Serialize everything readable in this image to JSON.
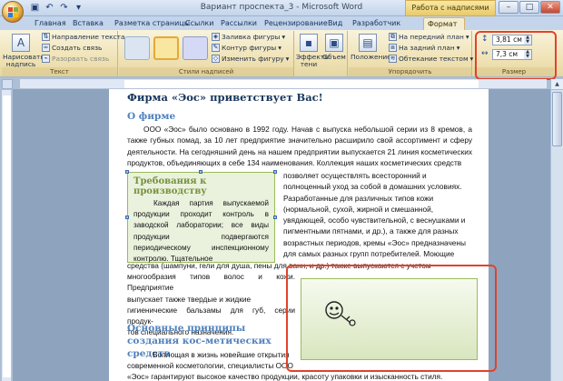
{
  "window": {
    "title": "Вариант проспекта_3 - Microsoft Word",
    "context_tab_header": "Работа с надписями"
  },
  "tabs": [
    "Главная",
    "Вставка",
    "Разметка страницы",
    "Ссылки",
    "Рассылки",
    "Рецензирование",
    "Вид",
    "Разработчик",
    "Формат"
  ],
  "ribbon": {
    "text_group": {
      "label": "Текст",
      "draw_textbox": "Нарисовать надпись",
      "text_direction": "Направление текста",
      "create_link": "Создать связь",
      "break_link": "Разорвать связь"
    },
    "styles_group": {
      "label": "Стили надписей",
      "fill": "Заливка фигуры",
      "outline": "Контур фигуры",
      "change_shape": "Изменить фигуру",
      "style_colors": [
        "#dbe5f1",
        "#f9e6a0",
        "#d4daf5"
      ]
    },
    "effects_group": {
      "shadow": "Эффекты тени",
      "volume": "Объем"
    },
    "arrange_group": {
      "label": "Упорядочить",
      "position": "Положение",
      "front": "На передний план",
      "back": "На задний план",
      "wrap": "Обтекание текстом"
    },
    "size_group": {
      "label": "Размер",
      "height": "3,81 см",
      "width": "7,3 см"
    }
  },
  "document": {
    "title": "Фирма «Эос» приветствует Вас!",
    "about_heading": "О фирме",
    "about_text": "ООО «Эос» было основано в 1992 году. Начав с выпуска небольшой серии из 8 кремов, а также губных помад, за 10 лет предприятие значительно расширило свой ассортимент и сферу деятельности. На сегодняшний день на нашем предприятии выпускается 21 линия косметических продуктов, объединяющих в себе 134 наименования. Коллекция наших косметических средств",
    "right_col": [
      "позволяет осуществлять всесторонний и",
      "полноценный уход за собой в домашних условиях.",
      "Разработанные для различных типов кожи",
      "(нормальной, сухой, жирной и смешанной,",
      "увядающей, особо чувствительной, с веснушками и",
      "пигментными пятнами, и др.), а также для разных",
      "возрастных периодов, кремы «Эос» предназначены",
      "для самых разных групп потребителей. Моющие"
    ],
    "full_line": "средства (шампуни, гели для душа, пены для ванн, и др.) также выпускаются с учетом",
    "left_col": [
      "многообразия типов волос и кожи. Предприятие",
      "выпускает также твердые и жидкие",
      "гигиенические бальзамы для губ, серии продук-",
      "тов специального назначения."
    ],
    "side_heading": "Требования к производству",
    "side_text": "Каждая партия выпускаемой продукции проходит контроль в заводской лаборатории; все виды продукции подвергаются периодическому инспекционному контролю. Тщательное",
    "principles_heading": "Основные принципы создания кос-метических средств",
    "principles_line1": "Воплощая в жизнь новейшие открытия",
    "principles_line2": "современной косметологии, специалисты ООО",
    "last_line": "«Эос» гарантируют высокое качество продукции, красоту упаковки и изысканность стиля."
  }
}
